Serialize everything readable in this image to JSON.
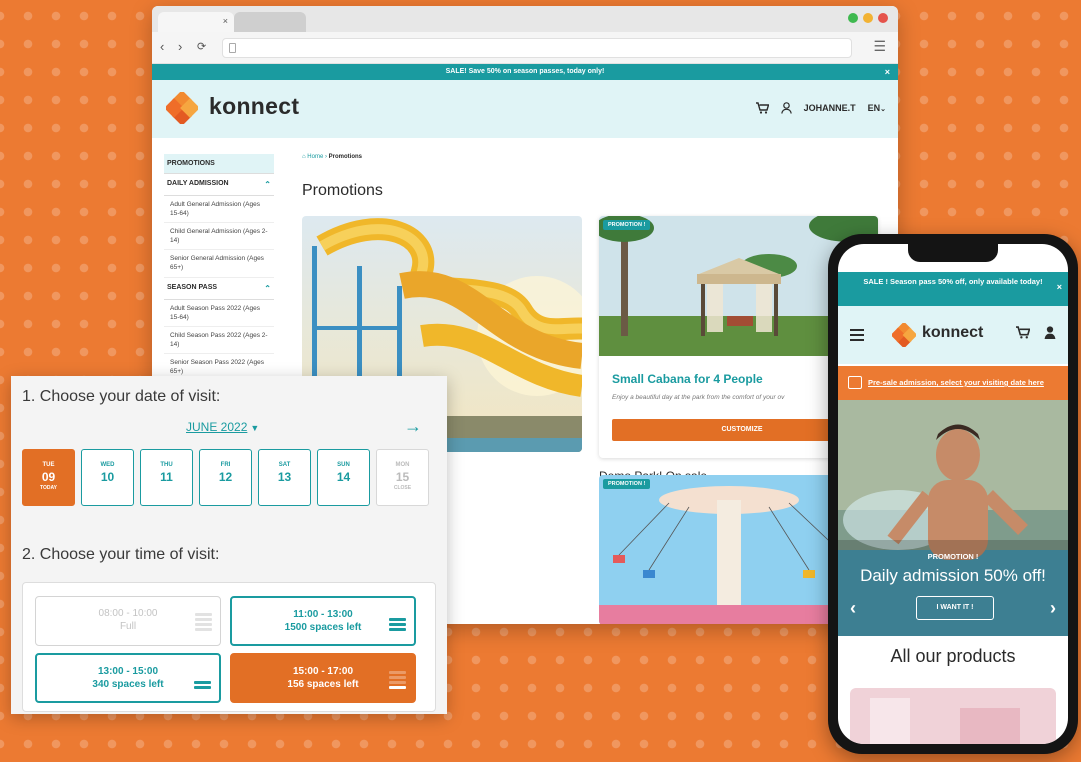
{
  "colors": {
    "background": "#ec7a32",
    "teal": "#1a9ba0",
    "orange": "#e26f25",
    "light_teal": "#e0f4f6"
  },
  "browser": {
    "tab_close": "×",
    "sale_banner": "SALE! Save 50% on season passes, today only!",
    "sale_close": "×",
    "header": {
      "brand": "konnect",
      "user": "JOHANNE.T",
      "lang": "EN"
    },
    "sidebar": {
      "promotions": "PROMOTIONS",
      "groups": [
        {
          "title": "DAILY ADMISSION",
          "items": [
            "Adult General Admission (Ages 15-64)",
            "Child General Admission (Ages 2-14)",
            "Senior General Admission (Ages 65+)"
          ]
        },
        {
          "title": "SEASON PASS",
          "items": [
            "Adult Season Pass 2022 (Ages 15-64)",
            "Child Season Pass 2022 (Ages 2-14)",
            "Senior Season Pass 2022 (Ages 65+)"
          ]
        }
      ]
    },
    "breadcrumb": {
      "home": "Home",
      "current": "Promotions"
    },
    "page_title": "Promotions",
    "cards": [
      {
        "title": "Demo Park! On sale"
      },
      {
        "badge": "PROMOTION !",
        "title": "Small Cabana for 4 People",
        "description": "Enjoy a beautiful day at the park from the comfort of your ov",
        "button": "CUSTOMIZE"
      },
      {
        "badge": "PROMOTION !"
      }
    ]
  },
  "calendar": {
    "date_heading": "1. Choose your date of visit:",
    "month": "JUNE 2022",
    "time_heading": "2. Choose your time of visit:",
    "days": [
      {
        "name": "TUE",
        "date": "09",
        "label": "TODAY",
        "state": "today"
      },
      {
        "name": "WED",
        "date": "10",
        "label": "",
        "state": "open"
      },
      {
        "name": "THU",
        "date": "11",
        "label": "",
        "state": "open"
      },
      {
        "name": "FRI",
        "date": "12",
        "label": "",
        "state": "open"
      },
      {
        "name": "SAT",
        "date": "13",
        "label": "",
        "state": "open"
      },
      {
        "name": "SUN",
        "date": "14",
        "label": "",
        "state": "open"
      },
      {
        "name": "MON",
        "date": "15",
        "label": "CLOSE",
        "state": "closed"
      }
    ],
    "slots": [
      {
        "time": "08:00 - 10:00",
        "status": "Full",
        "state": "full"
      },
      {
        "time": "11:00 - 13:00",
        "status": "1500 spaces left",
        "state": "open"
      },
      {
        "time": "13:00 - 15:00",
        "status": "340 spaces left",
        "state": "open"
      },
      {
        "time": "15:00 - 17:00",
        "status": "156 spaces left",
        "state": "selected"
      }
    ]
  },
  "phone": {
    "sale_banner": "SALE ! Season pass 50% off, only available today!",
    "sale_close": "×",
    "brand": "konnect",
    "presale_link": "Pre-sale admission, select your visiting date here",
    "hero": {
      "badge": "PROMOTION !",
      "title": "Daily admission 50% off!",
      "button": "I WANT IT !"
    },
    "section_title": "All our products"
  }
}
